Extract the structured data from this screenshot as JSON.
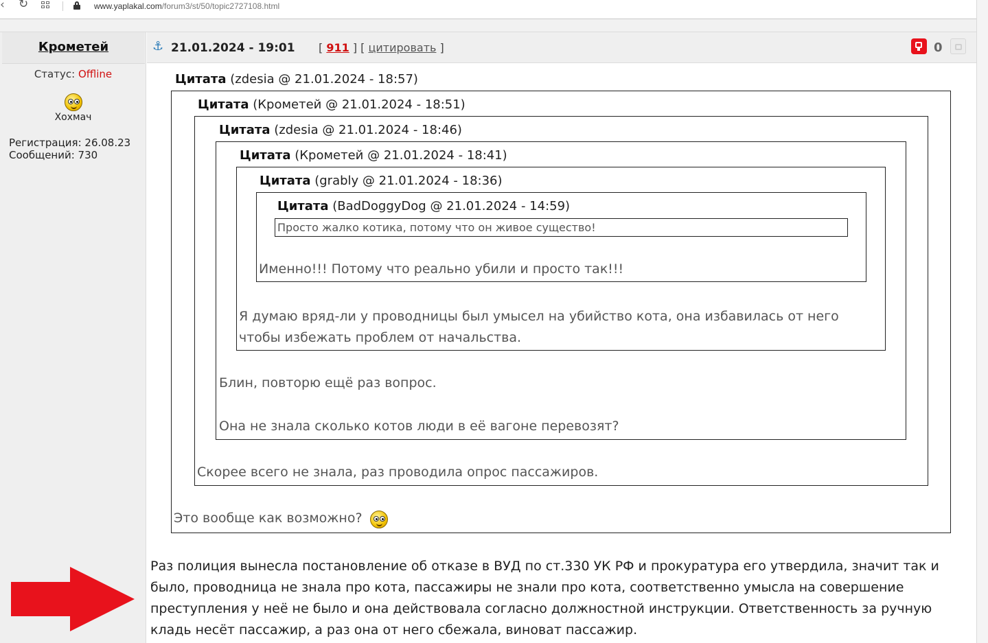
{
  "browser": {
    "url_host": "www.yaplakal.com",
    "url_path": "/forum3/st/50/topic2727108.html"
  },
  "user": {
    "name": "Крометей",
    "status_label": "Статус:",
    "status_value": "Offline",
    "rank": "Хохмач",
    "registration": "Регистрация: 26.08.23",
    "messages": "Сообщений: 730"
  },
  "post": {
    "date": "21.01.2024 - 19:01",
    "bracket_open": "[",
    "number": "911",
    "bracket_mid": "] [",
    "cite_label": "цитировать",
    "bracket_close": "]",
    "rating": "0"
  },
  "quotes": [
    {
      "label": "Цитата",
      "meta": "(zdesia @ 21.01.2024 - 18:57)"
    },
    {
      "label": "Цитата",
      "meta": "(Крометей @ 21.01.2024 - 18:51)"
    },
    {
      "label": "Цитата",
      "meta": "(zdesia @ 21.01.2024 - 18:46)"
    },
    {
      "label": "Цитата",
      "meta": "(Крометей @ 21.01.2024 - 18:41)"
    },
    {
      "label": "Цитата",
      "meta": "(grably @ 21.01.2024 - 18:36)"
    },
    {
      "label": "Цитата",
      "meta": "(BadDoggyDog @ 21.01.2024 - 14:59)"
    }
  ],
  "quote_texts": {
    "q6": "Просто жалко котика, потому что он живое существо!",
    "q5": "Именно!!! Потому что реально убили и просто так!!!",
    "q4_line1": "Я думаю вряд-ли у проводницы был умысел на убийство кота, она избавилась от него",
    "q4_line2": "чтобы избежать проблем от начальства.",
    "q3_line1": "Блин, повторю ещё раз вопрос.",
    "q3_line2": "Она не знала сколько котов люди в её вагоне перевозят?",
    "q2": "Скорее всего не знала, раз проводила опрос пассажиров.",
    "q1": "Это вообще как возможно?"
  },
  "main_text": "Раз полиция вынесла постановление об отказе в ВУД по ст.330 УК РФ и прокуратура его утвердила, значит так и было, проводница не знала про кота, пассажиры не знали про кота, соответственно умысла на совершение преступления у неё не было и она действовала согласно должностной инструкции. Ответственность за ручную кладь несёт пассажир, а раз она от него сбежала, виноват пассажир.",
  "colors": {
    "offline": "#d01010",
    "post_number": "#d01010",
    "rate_down": "#e8121c",
    "arrow": "#e8121c",
    "anchor": "#2a7bb8"
  },
  "icons": [
    "back-icon",
    "reload-icon",
    "tabs-grid-icon",
    "lock-icon",
    "anchor-icon",
    "rate-down-icon",
    "rate-up-icon",
    "smiley-icon",
    "arrow-pointer"
  ]
}
